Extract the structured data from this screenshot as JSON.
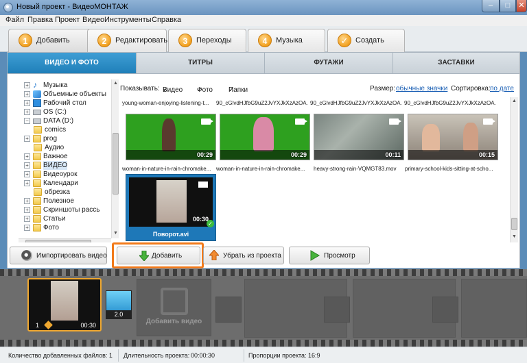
{
  "window": {
    "title": "Новый проект - ВидеоМОНТАЖ",
    "min": "–",
    "max": "□",
    "close": "✕"
  },
  "menu": [
    "Файл",
    "Правка",
    "Проект",
    "Видео",
    "Инструменты",
    "Справка"
  ],
  "steps": [
    {
      "num": "1",
      "label": "Добавить",
      "active": true
    },
    {
      "num": "2",
      "label": "Редактировать"
    },
    {
      "num": "3",
      "label": "Переходы"
    },
    {
      "num": "4",
      "label": "Музыка"
    },
    {
      "num": "✓",
      "label": "Создать"
    }
  ],
  "categories": [
    "ВИДЕО И ФОТО",
    "ТИТРЫ",
    "ФУТАЖИ",
    "ЗАСТАВКИ"
  ],
  "tree": {
    "items": [
      {
        "label": "Музыка",
        "icon": "music-note-icon"
      },
      {
        "label": "Объемные объекты",
        "icon": "3d-objects-icon"
      },
      {
        "label": "Рабочий стол",
        "icon": "desktop-icon"
      },
      {
        "label": "OS (C:)",
        "icon": "drive-icon"
      },
      {
        "label": "DATA (D:)",
        "icon": "drive-icon"
      },
      {
        "label": "comics",
        "icon": "folder-icon"
      },
      {
        "label": "prog",
        "icon": "folder-icon"
      },
      {
        "label": "Аудио",
        "icon": "folder-icon"
      },
      {
        "label": "Важное",
        "icon": "folder-icon"
      },
      {
        "label": "ВИДЕО",
        "icon": "folder-icon"
      },
      {
        "label": "Видеоурок",
        "icon": "folder-icon"
      },
      {
        "label": "Календари",
        "icon": "folder-icon"
      },
      {
        "label": "обрезка",
        "icon": "folder-icon"
      },
      {
        "label": "Полезное",
        "icon": "folder-icon"
      },
      {
        "label": "Скриншоты рассь",
        "icon": "folder-icon"
      },
      {
        "label": "Статьи",
        "icon": "folder-icon"
      },
      {
        "label": "Фото",
        "icon": "folder-icon"
      }
    ]
  },
  "filter": {
    "show_label": "Показывать:",
    "video": "Видео",
    "photo": "Фото",
    "folders": "Папки",
    "size_label": "Размер:",
    "size_value": "обычные значки",
    "sort_label": "Сортировка:",
    "sort_value": "по дате"
  },
  "top_titles": [
    "young-woman-enjoying-listening-t...",
    "90_cGlvdHJfbG9uZ2JvYXJkXzAzOA...",
    "90_cGlvdHJfbG9uZ2JvYXJkXzAzOA...",
    "90_cGlvdHJfbG9uZ2JvYXJkXzAzOA..."
  ],
  "videos": [
    {
      "name": "woman-in-nature-in-rain-chromake...",
      "duration": "00:29"
    },
    {
      "name": "woman-in-nature-in-rain-chromake...",
      "duration": "00:29"
    },
    {
      "name": "heavy-strong-rain-VQMGT83.mov",
      "duration": "00:11"
    },
    {
      "name": "primary-school-kids-sitting-at-scho...",
      "duration": "00:15"
    }
  ],
  "selected": {
    "name": "Поворот.avi",
    "duration": "00:30"
  },
  "buttons": {
    "import": "Импортировать видео",
    "add": "Добавить",
    "remove": "Убрать из проекта",
    "preview": "Просмотр"
  },
  "timeline": {
    "clip_num": "1",
    "clip_duration": "00:30",
    "transition_duration": "2.0",
    "add_video": "Добавить видео"
  },
  "status": {
    "files": "Количество добавленных файлов: 1",
    "length_label": "Длительность проекта:",
    "length_value": "00:00:30",
    "ratio_label": "Пропорции проекта:",
    "ratio_value": "16:9"
  }
}
